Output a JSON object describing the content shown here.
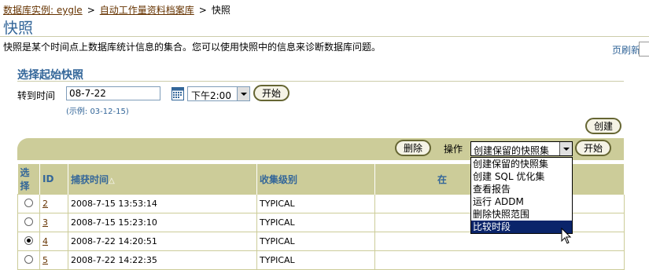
{
  "breadcrumb": {
    "items": [
      "数据库实例: eygle",
      "自动工作量资料档案库",
      "快照"
    ],
    "separator": ">"
  },
  "page": {
    "title": "快照",
    "description": "快照是某个时间点上数据库统计信息的集合。您可以使用快照中的信息来诊断数据库问题。",
    "refresh_label": "页刷新"
  },
  "section": {
    "title": "选择起始快照",
    "goto_label": "转到时间",
    "date_value": "08-7-22",
    "time_value": "下午2:00",
    "start_label": "开始",
    "example_text": "(示例: 03-12-15)"
  },
  "toolbar": {
    "create_label": "创建",
    "delete_label": "删除",
    "operation_label": "操作",
    "operation_value": "创建保留的快照集",
    "start_label": "开始",
    "operation_options": [
      "创建保留的快照集",
      "创建 SQL 优化集",
      "查看报告",
      "运行 ADDM",
      "删除快照范围",
      "比较时段"
    ],
    "highlighted_option": "比较时段"
  },
  "table": {
    "headers": {
      "select": "选择",
      "id": "ID",
      "capture_time": "捕获时间",
      "sort_indicator": "△",
      "collect_level": "收集级别",
      "extra": "在"
    },
    "rows": [
      {
        "id": "2",
        "time": "2008-7-15 13:53:14",
        "level": "TYPICAL",
        "selected": false
      },
      {
        "id": "3",
        "time": "2008-7-15 15:23:10",
        "level": "TYPICAL",
        "selected": false
      },
      {
        "id": "4",
        "time": "2008-7-22 14:20:51",
        "level": "TYPICAL",
        "selected": true
      },
      {
        "id": "5",
        "time": "2008-7-22 14:22:35",
        "level": "TYPICAL",
        "selected": false
      }
    ]
  },
  "icons": {
    "calendar": "calendar-icon",
    "cursor": "mouse-pointer-icon"
  }
}
